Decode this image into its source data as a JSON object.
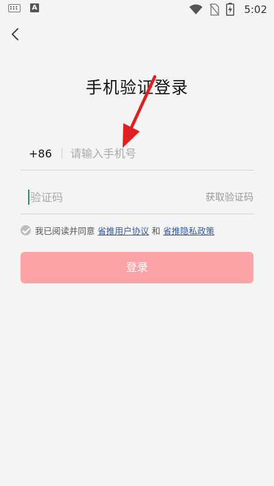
{
  "status_bar": {
    "time": "5:02",
    "left_icons": [
      "keyboard-icon",
      "a-app-icon"
    ],
    "right_icons": [
      "wifi-icon",
      "no-sim-icon",
      "battery-charging-icon"
    ]
  },
  "header": {
    "back_icon": "chevron-left-icon"
  },
  "title": "手机验证登录",
  "phone": {
    "country_code": "+86",
    "placeholder": "请输入手机号"
  },
  "code": {
    "placeholder": "验证码",
    "get_code_label": "获取验证码"
  },
  "agreement": {
    "prefix": "我已阅读并同意",
    "user_agreement": "省推用户协议",
    "conjunction": "和",
    "privacy_policy": "省推隐私政策"
  },
  "login_button": "登录",
  "colors": {
    "background": "#f4f4f4",
    "login_button": "#fba3a6",
    "link": "#355a9c",
    "annotation_arrow": "#e02020",
    "caret": "#2a8c5c"
  }
}
